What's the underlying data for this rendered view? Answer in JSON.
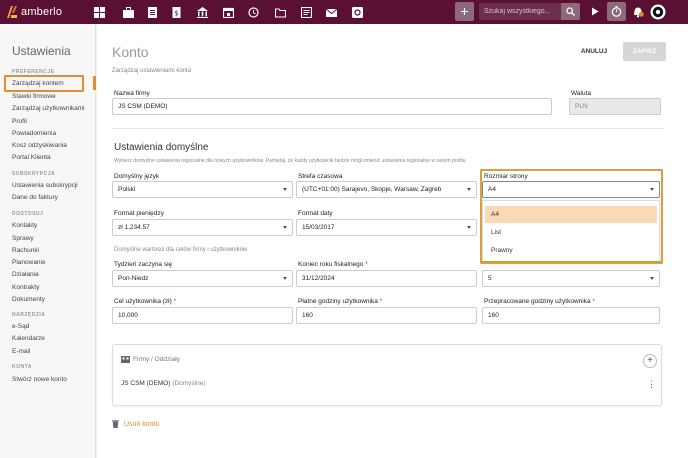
{
  "app": {
    "logo_text": "amberlo"
  },
  "topbar": {
    "nav_icons": [
      "dashboard-icon",
      "briefcase-icon",
      "document-icon",
      "bank-icon",
      "calendar-icon",
      "history-icon",
      "folder-icon",
      "docs-icon",
      "mail-icon",
      "gear-icon"
    ],
    "search_placeholder": "Szukaj wszystkiego...",
    "plus_label": "+"
  },
  "sidebar": {
    "title": "Ustawienia",
    "sections": [
      {
        "label": "PREFERENCJE",
        "items": [
          "Zarządzaj kontem",
          "Stawki firmowe",
          "Zarządzaj użytkownikami",
          "Profil",
          "Powiadomienia",
          "Kosz odzyskiwania",
          "Portal Klienta"
        ]
      },
      {
        "label": "SUBSKRYPCJA",
        "items": [
          "Ustawienia subskrypcji",
          "Dane do faktury"
        ]
      },
      {
        "label": "DOSTOSUJ",
        "items": [
          "Kontakty",
          "Sprawy",
          "Rachunki",
          "Planowanie",
          "Działania",
          "Kontrakty",
          "Dokumenty"
        ]
      },
      {
        "label": "NARZĘDZIA",
        "items": [
          "e-Sąd",
          "Kalendarze",
          "E-mail"
        ]
      },
      {
        "label": "KONTA",
        "items": [
          "Stwórz nowe konto"
        ]
      }
    ]
  },
  "header": {
    "title": "Konto",
    "subtitle": "Zarządzaj ustawieniami konta",
    "cancel_label": "ANULUJ",
    "save_label": "ZAPISZ"
  },
  "company": {
    "name_label": "Nazwa firmy",
    "name_value": "JS CSM (DEMO)",
    "currency_label": "Waluta",
    "currency_value": "PLN"
  },
  "defaults": {
    "title": "Ustawienia domyślne",
    "description": "Wybierz domyślne ustawienia regionalne dla nowych użytkowników. Pamiętaj, że każdy użytkownik będzie mógł zmienić ustawienia regionalne w swoim profilu",
    "language_label": "Domyślny język",
    "language_value": "Polski",
    "timezone_label": "Strefa czasowa",
    "timezone_value": "(UTC+01:00) Sarajevo, Skopje, Warsaw, Zagreb",
    "page_size_label": "Rozmiar strony",
    "page_size_value": "A4",
    "money_format_label": "Format pieniędzy",
    "money_format_value": "zł 1,234.57",
    "date_format_label": "Format daty",
    "date_format_value": "15/03/2017",
    "page_size_options": [
      "A4",
      "List",
      "Prawny"
    ],
    "page_size_selected_index": 0
  },
  "firm_defaults": {
    "description": "Domyślne wartości dla celów firmy i użytkowników",
    "week_start_label": "Tydzień zaczyna się",
    "week_start_value": "Pon-Niedz",
    "fiscal_end_label": "Koniec roku fiskalnego",
    "fiscal_end_value": "31/12/2024",
    "workdays_value": "5",
    "user_goal_label": "Cel użytkownika (zł)",
    "user_goal_value": "10,000",
    "billable_hours_label": "Płatne godziny użytkownika",
    "billable_hours_value": "160",
    "worked_hours_label": "Przepracowane godziny użytkownika",
    "worked_hours_value": "160",
    "required_mark": "*"
  },
  "firms_card": {
    "title": "Firmy / Oddziały",
    "row_name": "JS CSM (DEMO)",
    "row_default": "(Domyślne)",
    "add_label": "+",
    "menu_label": "⋮"
  },
  "delete_account_label": "Usuń konto",
  "colors": {
    "topbar": "#5a1032",
    "accent": "#e58c2c",
    "dropdown_border": "#d9a03d",
    "dropdown_bottom": "#9cb03a",
    "selected_option": "#fbd9b5"
  }
}
